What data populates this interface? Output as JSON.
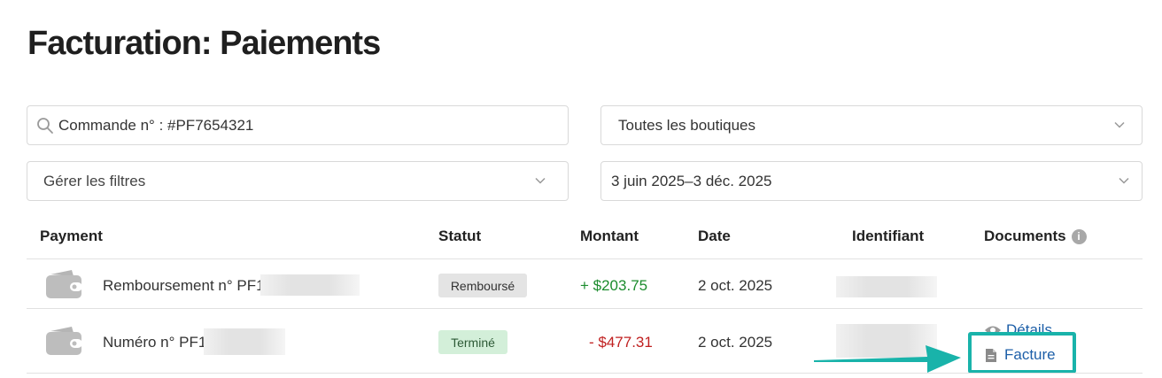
{
  "page": {
    "title": "Facturation: Paiements"
  },
  "filters": {
    "search_value": "Commande n° : #PF7654321",
    "store": "Toutes les boutiques",
    "manage_filters": "Gérer les filtres",
    "date_range": "3 juin 2025–3 déc. 2025"
  },
  "table": {
    "columns": [
      "Payment",
      "Statut",
      "Montant",
      "Date",
      "Identifiant",
      "Documents"
    ],
    "rows": [
      {
        "payment": "Remboursement n° PF1",
        "status": "Remboursé",
        "amount": "+ $203.75",
        "date": "2 oct. 2025"
      },
      {
        "payment": "Numéro n° PF1",
        "status": "Terminé",
        "amount": "- $477.31",
        "date": "2 oct. 2025",
        "documents": {
          "details": "Détails",
          "invoice": "Facture"
        }
      }
    ]
  },
  "colors": {
    "highlight": "#19b3aa",
    "link": "#1d5fa8",
    "positive": "#1c8c2e",
    "negative": "#c02020"
  }
}
